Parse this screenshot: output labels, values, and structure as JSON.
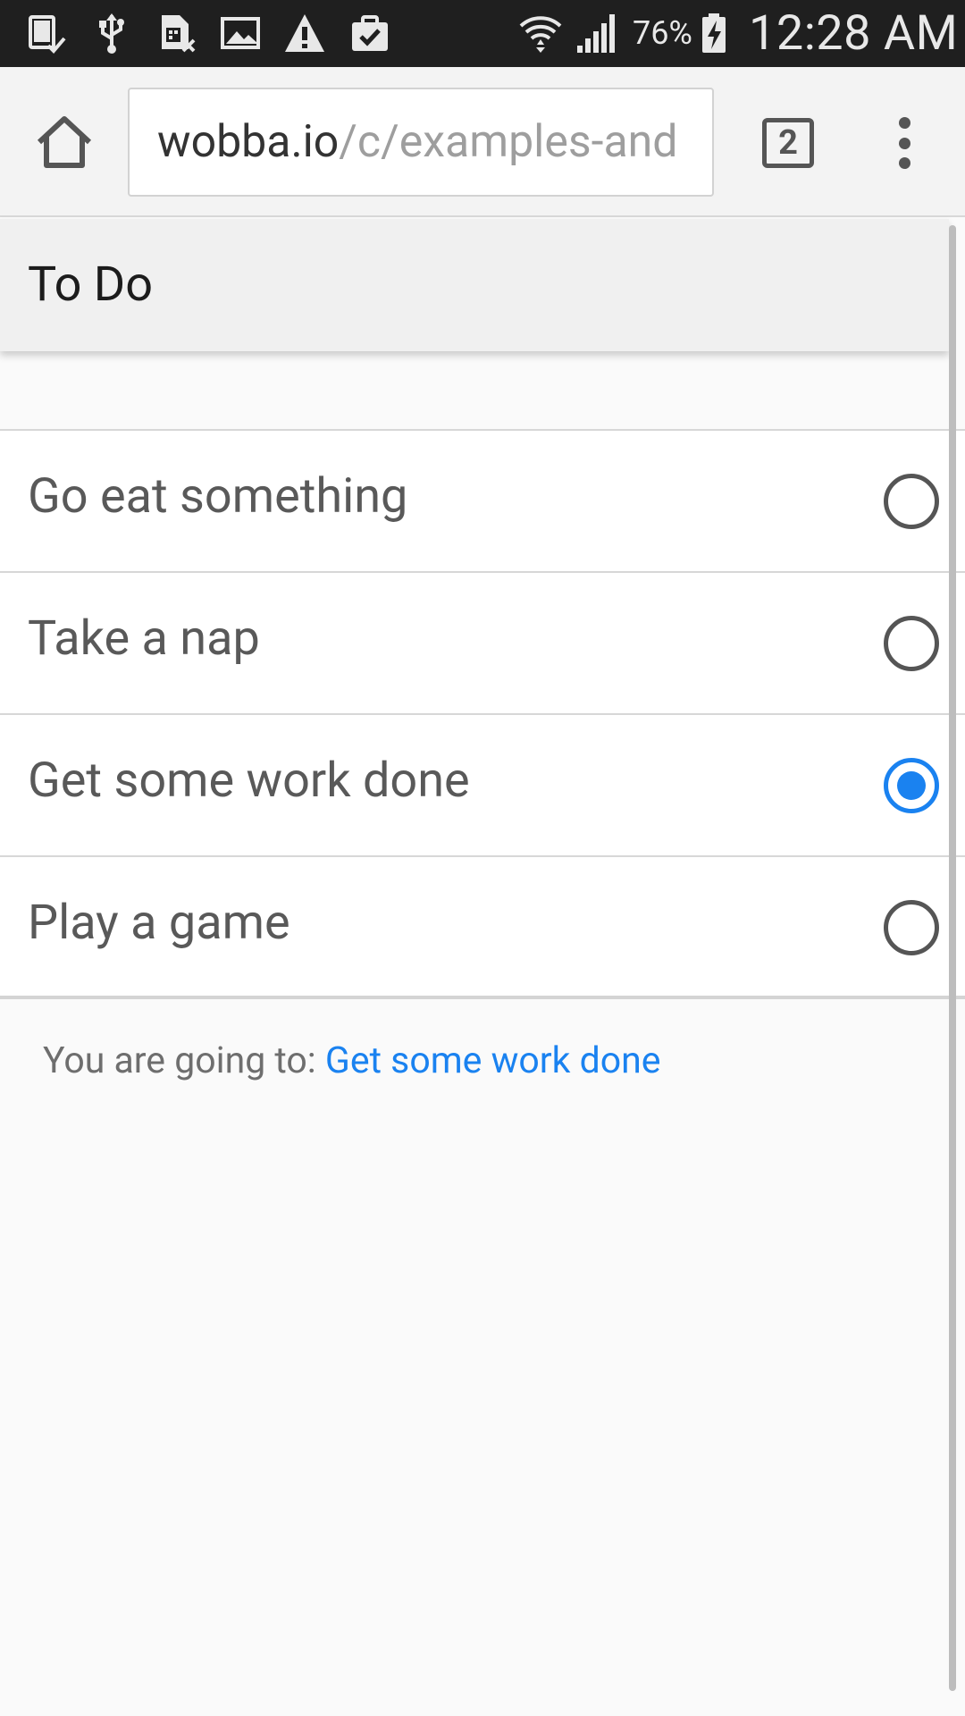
{
  "status_bar": {
    "battery_percent": "76%",
    "time": "12:28 AM",
    "icons": [
      "tablet-check-icon",
      "usb-icon",
      "sim-card-x-icon",
      "image-icon",
      "warning-icon",
      "clipboard-check-icon",
      "wifi-icon",
      "signal-icon",
      "battery-charging-icon"
    ]
  },
  "browser": {
    "url_host": "wobba.io",
    "url_path": "/c/examples-and",
    "tab_count": "2"
  },
  "app": {
    "title": "To Do"
  },
  "todo": {
    "items": [
      {
        "label": "Go eat something",
        "selected": false
      },
      {
        "label": "Take a nap",
        "selected": false
      },
      {
        "label": "Get some work done",
        "selected": true
      },
      {
        "label": "Play a game",
        "selected": false
      }
    ]
  },
  "result": {
    "prefix": "You are going to: ",
    "value": "Get some work done"
  },
  "colors": {
    "accent": "#1a82f0",
    "status_bar_bg": "#1f1f1f",
    "toolbar_bg": "#f3f3f3",
    "header_bg": "#f0f0f0"
  }
}
